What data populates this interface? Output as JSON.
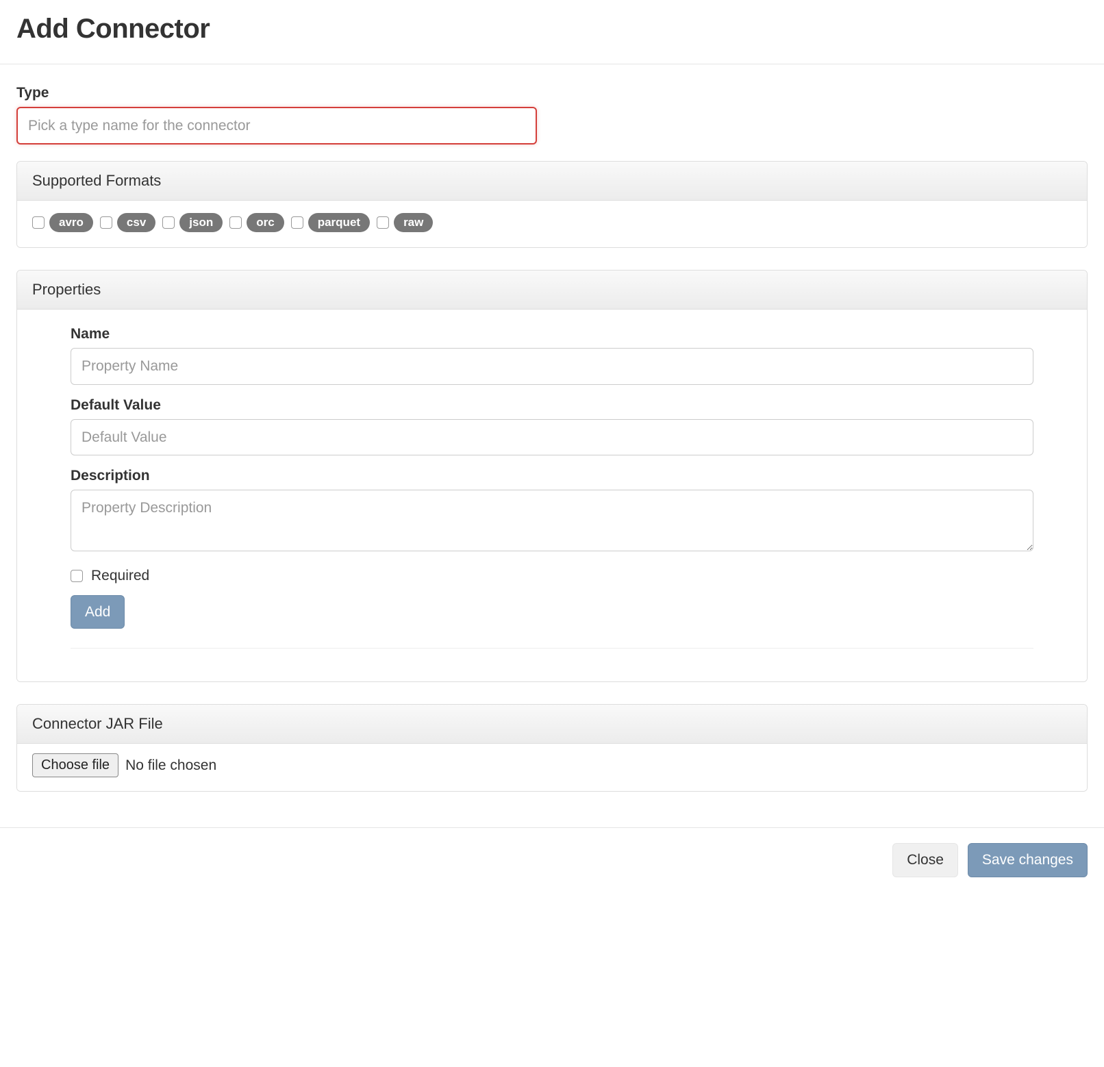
{
  "header": {
    "title": "Add Connector"
  },
  "typeField": {
    "label": "Type",
    "placeholder": "Pick a type name for the connector",
    "value": ""
  },
  "supportedFormats": {
    "heading": "Supported Formats",
    "items": [
      {
        "label": "avro"
      },
      {
        "label": "csv"
      },
      {
        "label": "json"
      },
      {
        "label": "orc"
      },
      {
        "label": "parquet"
      },
      {
        "label": "raw"
      }
    ]
  },
  "properties": {
    "heading": "Properties",
    "nameLabel": "Name",
    "namePlaceholder": "Property Name",
    "defaultLabel": "Default Value",
    "defaultPlaceholder": "Default Value",
    "descLabel": "Description",
    "descPlaceholder": "Property Description",
    "requiredLabel": "Required",
    "addButton": "Add"
  },
  "jar": {
    "heading": "Connector JAR File",
    "chooseLabel": "Choose file",
    "status": "No file chosen"
  },
  "footer": {
    "close": "Close",
    "save": "Save changes"
  }
}
